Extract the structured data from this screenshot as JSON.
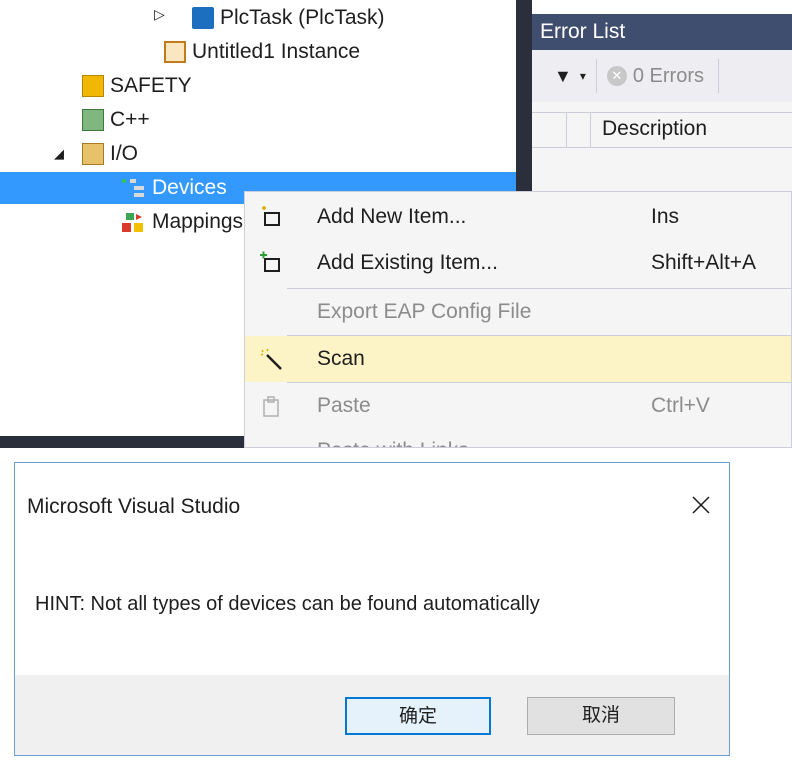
{
  "tree": {
    "items": [
      {
        "label": "PlcTask (PlcTask)",
        "icon": "task-icon"
      },
      {
        "label": "Untitled1 Instance",
        "icon": "instance-icon"
      },
      {
        "label": "SAFETY",
        "icon": "safety-icon"
      },
      {
        "label": "C++",
        "icon": "cpp-icon"
      },
      {
        "label": "I/O",
        "icon": "io-icon"
      },
      {
        "label": "Devices",
        "icon": "devices-icon"
      },
      {
        "label": "Mappings",
        "icon": "mappings-icon"
      }
    ]
  },
  "error_list": {
    "title": "Error List",
    "errors_label": "0 Errors",
    "column_description": "Description"
  },
  "context_menu": {
    "items": [
      {
        "label": "Add New Item...",
        "shortcut": "Ins",
        "enabled": true,
        "icon": "add-new-item-icon"
      },
      {
        "label": "Add Existing Item...",
        "shortcut": "Shift+Alt+A",
        "enabled": true,
        "icon": "add-existing-item-icon"
      },
      {
        "label": "Export EAP Config File",
        "shortcut": "",
        "enabled": false
      },
      {
        "label": "Scan",
        "shortcut": "",
        "enabled": true,
        "highlighted": true,
        "icon": "scan-wand-icon"
      },
      {
        "label": "Paste",
        "shortcut": "Ctrl+V",
        "enabled": false,
        "icon": "paste-icon"
      },
      {
        "label": "Paste with Links",
        "shortcut": "",
        "enabled": false
      }
    ]
  },
  "dialog": {
    "title": "Microsoft Visual Studio",
    "message": "HINT: Not all types of devices can be found automatically",
    "ok_label": "确定",
    "cancel_label": "取消"
  },
  "colors": {
    "selection": "#3399ff",
    "menu_highlight": "#fcf3c6",
    "error_list_title": "#3f4d6e",
    "dialog_default_button_border": "#0078d7"
  }
}
